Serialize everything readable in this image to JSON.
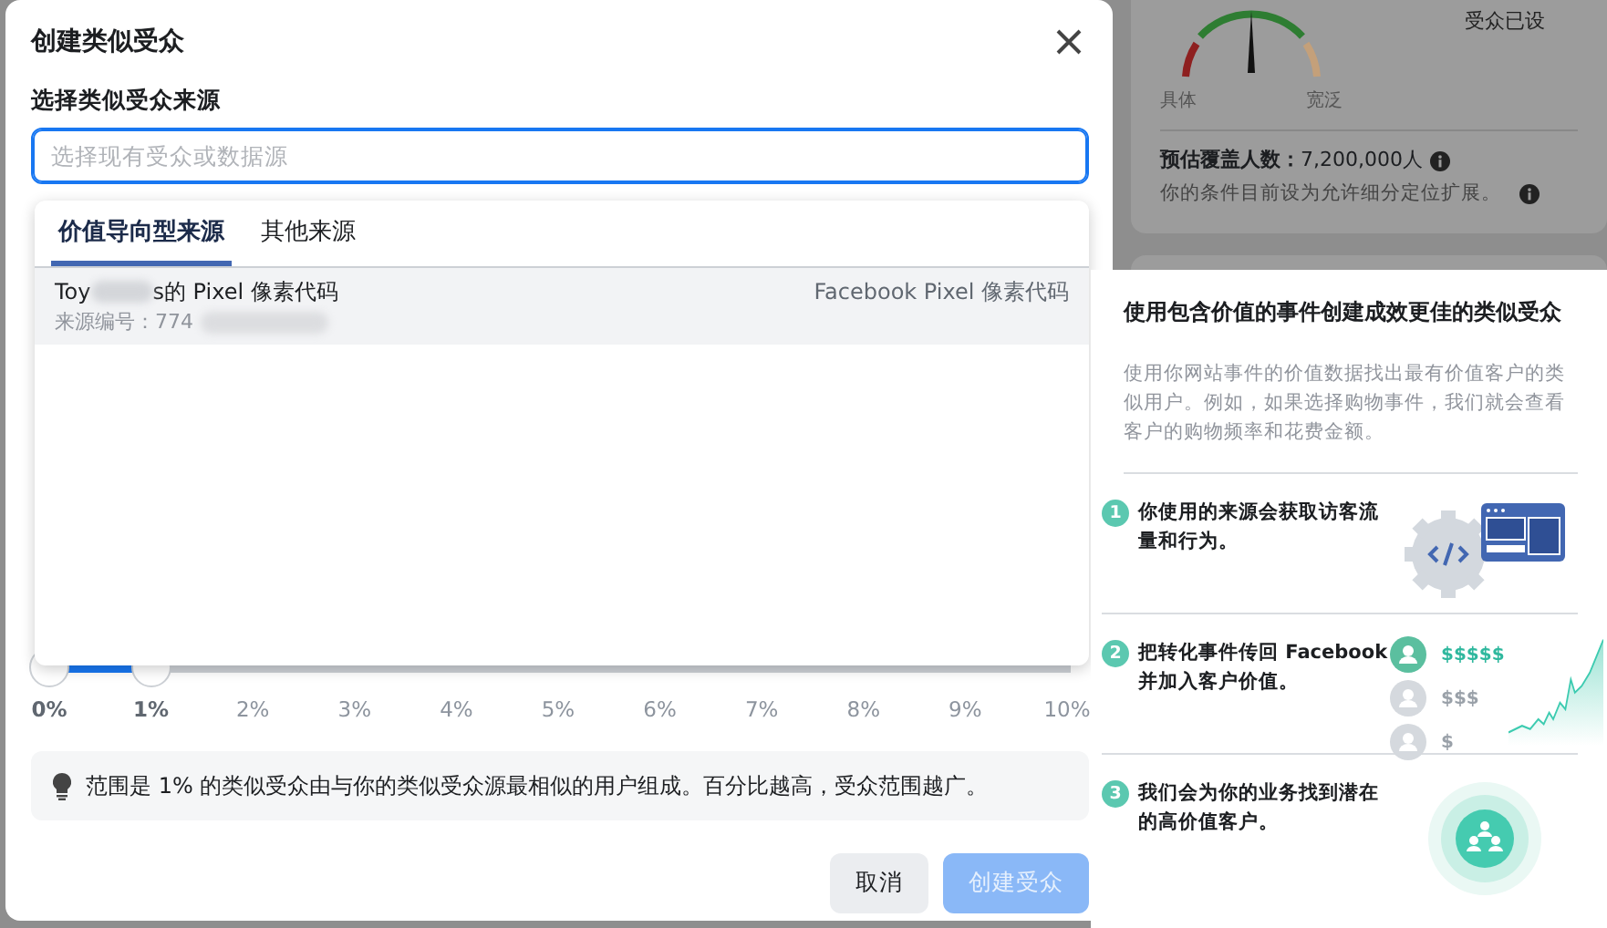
{
  "background": {
    "gauge_labels": [
      "具体",
      "宽泛"
    ],
    "corner_text": "受众已设",
    "reach_label": "预估覆盖人数：",
    "reach_value": "7,200,000人",
    "note": "你的条件目前设为允许细分定位扩展。"
  },
  "dialog": {
    "title": "创建类似受众",
    "source_label": "选择类似受众来源",
    "search": {
      "placeholder": "选择现有受众或数据源"
    },
    "tabs": [
      {
        "label": "价值导向型来源",
        "selected": true
      },
      {
        "label": "其他来源",
        "selected": false
      }
    ],
    "sources": [
      {
        "name_start": "Toy",
        "name_end": "s的 Pixel 像素代码",
        "source_id": "来源编号：774",
        "type": "Facebook Pixel 像素代码",
        "highlighted": true
      }
    ],
    "slider": {
      "level": 0.1,
      "ticks": [
        {
          "label": "0%",
          "selected": true
        },
        {
          "label": "1%",
          "selected": true
        },
        {
          "label": "2%",
          "selected": false
        },
        {
          "label": "3%",
          "selected": false
        },
        {
          "label": "4%",
          "selected": false
        },
        {
          "label": "5%",
          "selected": false
        },
        {
          "label": "6%",
          "selected": false
        },
        {
          "label": "7%",
          "selected": false
        },
        {
          "label": "8%",
          "selected": false
        },
        {
          "label": "9%",
          "selected": false
        },
        {
          "label": "10%",
          "selected": false
        }
      ]
    },
    "tip": "范围是 1% 的类似受众由与你的类似受众源最相似的用户组成。百分比越高，受众范围越广。",
    "buttons": [
      {
        "label": "取消",
        "disabled": false,
        "kind": "secondary"
      },
      {
        "label": "创建受众",
        "disabled": true,
        "kind": "primary"
      }
    ]
  },
  "info_panel": {
    "title": "使用包含价值的事件创建成效更佳的类似受众",
    "description": "使用你网站事件的价值数据找出最有价值客户的类似用户。例如，如果选择购物事件，我们就会查看客户的购物频率和花费金额。",
    "steps": [
      {
        "number": "1",
        "text": "你使用的来源会获取访客流量和行为。",
        "kind": "pixel"
      },
      {
        "number": "2",
        "text": "把转化事件传回 Facebook 并加入客户价值。",
        "kind": "value",
        "values": [
          "$$$$$",
          "$$$",
          "$"
        ]
      },
      {
        "number": "3",
        "text": "我们会为你的业务找到潜在的高价值客户。",
        "kind": "audience"
      }
    ]
  }
}
